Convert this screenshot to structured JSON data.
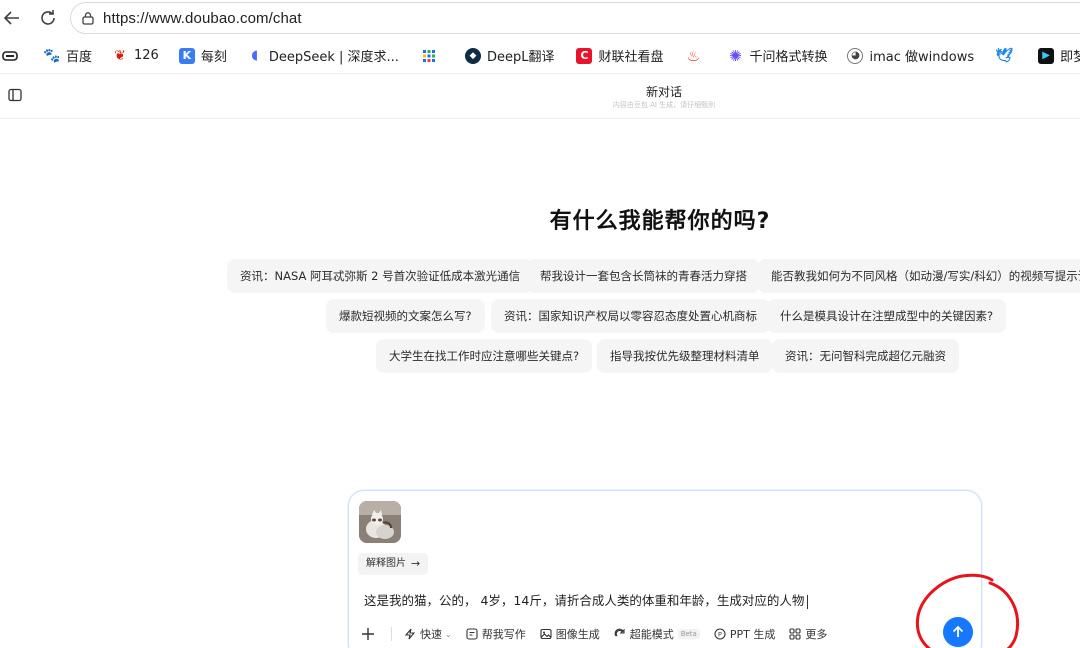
{
  "browser": {
    "url": "https://www.doubao.com/chat",
    "bookmarks": [
      {
        "label": "百度",
        "icon": "baidu-icon"
      },
      {
        "label": "126",
        "icon": "netease-126-icon"
      },
      {
        "label": "每刻",
        "icon": "meike-icon"
      },
      {
        "label": "DeepSeek | 深度求...",
        "icon": "deepseek-whale-icon"
      },
      {
        "label": "",
        "icon": "grid-apps-icon"
      },
      {
        "label": "DeepL翻译",
        "icon": "deepl-icon"
      },
      {
        "label": "财联社看盘",
        "icon": "cailianshe-icon"
      },
      {
        "label": "",
        "icon": "fire-icon"
      },
      {
        "label": "千问格式转换",
        "icon": "qianwen-icon"
      },
      {
        "label": "imac 做windows",
        "icon": "apple-logo-icon"
      },
      {
        "label": "",
        "icon": "bird-icon"
      },
      {
        "label": "即梦",
        "icon": "jimeng-icon"
      }
    ]
  },
  "header": {
    "title": "新对话",
    "subtitle": "内容由豆包 AI 生成，请仔细甄别"
  },
  "hero": {
    "title": "有什么我能帮你的吗?"
  },
  "suggestions": [
    "资讯：NASA 阿耳忒弥斯 2 号首次验证低成本激光通信",
    "帮我设计一套包含长筒袜的青春活力穿搭",
    "能否教我如何为不同风格（如动漫/写实/科幻）的视频写提示词",
    "爆款短视频的文案怎么写?",
    "资讯：国家知识产权局以零容忍态度处置心机商标",
    "什么是模具设计在注塑成型中的关键因素?",
    "大学生在找工作时应注意哪些关键点?",
    "指导我按优先级整理材料清单",
    "资讯：无问智科完成超亿元融资"
  ],
  "composer": {
    "explain_label": "解释图片",
    "prompt": "这是我的猫，公的， 4岁，14斤，请折合成人类的体重和年龄，生成对应的人物",
    "tools": {
      "quick": "快速",
      "write": "帮我写作",
      "image": "图像生成",
      "super": "超能模式",
      "beta": "Beta",
      "ppt": "PPT 生成",
      "more": "更多"
    }
  },
  "colors": {
    "accent": "#1677ff",
    "annotation": "#e8141c"
  }
}
